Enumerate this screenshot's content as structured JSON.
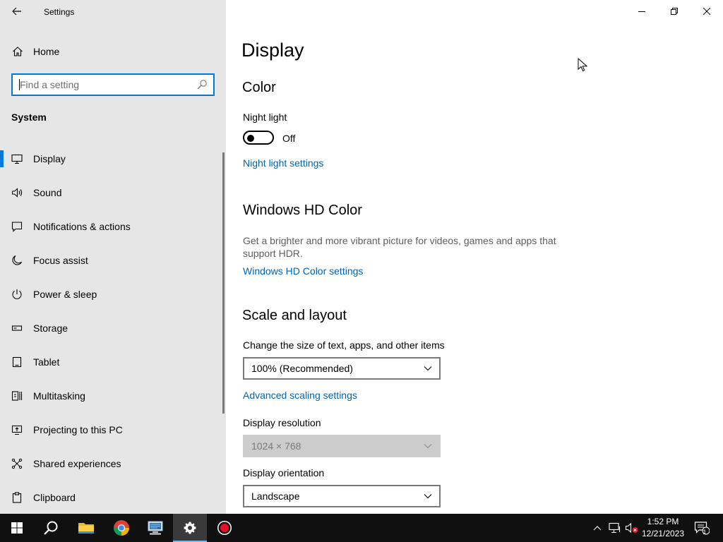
{
  "window": {
    "app_title": "Settings",
    "controls": [
      "minimize-icon",
      "restore-icon",
      "close-icon"
    ]
  },
  "sidebar": {
    "home_label": "Home",
    "search": {
      "placeholder": "Find a setting",
      "value": ""
    },
    "section_label": "System",
    "items": [
      {
        "label": "Display",
        "icon": "monitor-icon",
        "active": true
      },
      {
        "label": "Sound",
        "icon": "speaker-icon"
      },
      {
        "label": "Notifications & actions",
        "icon": "notification-icon"
      },
      {
        "label": "Focus assist",
        "icon": "moon-icon"
      },
      {
        "label": "Power & sleep",
        "icon": "power-icon"
      },
      {
        "label": "Storage",
        "icon": "storage-icon"
      },
      {
        "label": "Tablet",
        "icon": "tablet-icon"
      },
      {
        "label": "Multitasking",
        "icon": "multitasking-icon"
      },
      {
        "label": "Projecting to this PC",
        "icon": "projecting-icon"
      },
      {
        "label": "Shared experiences",
        "icon": "shared-experiences-icon"
      },
      {
        "label": "Clipboard",
        "icon": "clipboard-icon"
      }
    ]
  },
  "main": {
    "page_title": "Display",
    "color": {
      "heading": "Color",
      "night_light_label": "Night light",
      "night_light_state": "Off",
      "night_light_settings_link": "Night light settings"
    },
    "hd_color": {
      "heading": "Windows HD Color",
      "description": "Get a brighter and more vibrant picture for videos, games and apps that support HDR.",
      "settings_link": "Windows HD Color settings"
    },
    "scale_layout": {
      "heading": "Scale and layout",
      "scale_label": "Change the size of text, apps, and other items",
      "scale_value": "100% (Recommended)",
      "advanced_link": "Advanced scaling settings",
      "resolution_label": "Display resolution",
      "resolution_value": "1024 × 768",
      "orientation_label": "Display orientation",
      "orientation_value": "Landscape"
    }
  },
  "taskbar": {
    "apps": [
      "windows-start-icon",
      "search-icon",
      "file-explorer-icon",
      "chrome-icon",
      "network-computer-icon",
      "settings-gear-icon",
      "record-icon"
    ],
    "active_app": "settings-gear-icon",
    "tray": [
      "chevron-up-icon",
      "network-icon",
      "volume-muted-icon"
    ],
    "time": "1:52 PM",
    "date": "12/21/2023",
    "notification_count": "1"
  },
  "colors": {
    "accent": "#0078d7",
    "link": "#0063b1",
    "sidebar_bg": "#e6e6e6",
    "taskbar_bg": "#101010"
  }
}
